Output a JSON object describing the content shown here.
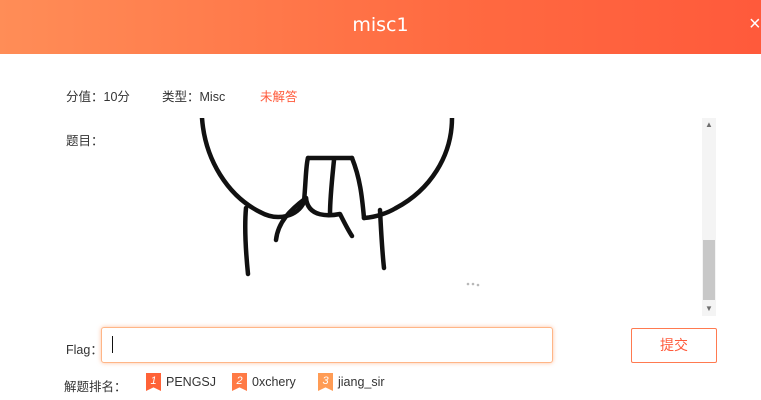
{
  "dialog": {
    "title": "misc1",
    "close_icon": "×"
  },
  "meta": {
    "score": "分值：10分",
    "type": "类型：Misc",
    "status": "未解答",
    "status_color": "#ff5a3b"
  },
  "question": {
    "label": "题目：",
    "image_icon": "cartoon-sketch-image"
  },
  "scrollbar": {
    "up_icon": "▲",
    "down_icon": "▼"
  },
  "flag": {
    "label": "Flag：",
    "value": "",
    "submit_label": "提交"
  },
  "ranking": {
    "label": "解题排名：",
    "entries": [
      {
        "rank": "1",
        "name": "PENGSJ",
        "color": "#ff6237"
      },
      {
        "rank": "2",
        "name": "0xchery",
        "color": "#ff7a45"
      },
      {
        "rank": "3",
        "name": "jiang_sir",
        "color": "#ff9c55"
      }
    ]
  },
  "colors": {
    "accent": "#ff6a41",
    "accent_light": "#ff8d57"
  }
}
